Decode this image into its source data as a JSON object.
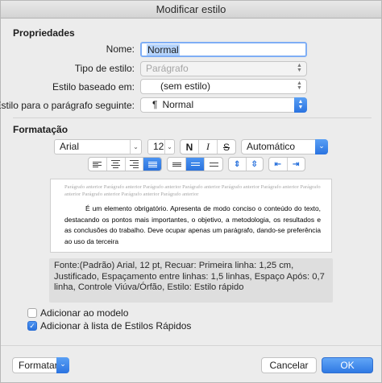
{
  "window": {
    "title": "Modificar estilo"
  },
  "properties": {
    "section_title": "Propriedades",
    "name_label": "Nome:",
    "name_value": "Normal",
    "style_type_label": "Tipo de estilo:",
    "style_type_value": "Parágrafo",
    "based_on_label": "Estilo baseado em:",
    "based_on_value": "(sem estilo)",
    "next_style_label": "Estilo para o parágrafo seguinte:",
    "next_style_symbol": "¶",
    "next_style_value": "Normal"
  },
  "formatting": {
    "section_title": "Formatação",
    "font": "Arial",
    "size": "12",
    "bold": "N",
    "italic": "I",
    "underline": "S",
    "color": "Automático"
  },
  "preview": {
    "ghost_text": "Parágrafo anterior Parágrafo anterior Parágrafo anterior Parágrafo anterior Parágrafo anterior Parágrafo anterior Parágrafo anterior Parágrafo anterior Parágrafo anterior Parágrafo anterior",
    "sample_text": "É um elemento obrigatório. Apresenta de modo conciso o conteúdo do texto, destacando os pontos mais importantes, o objetivo, a metodologia, os resultados e as conclusões do trabalho. Deve ocupar apenas um parágrafo, dando-se preferência ao uso da terceira"
  },
  "description": "Fonte:(Padrão) Arial, 12 pt, Recuar: Primeira linha: 1,25 cm, Justificado, Espaçamento entre linhas: 1,5 linhas, Espaço Após: 0,7 linha, Controle Viúva/Órfão, Estilo: Estilo rápido",
  "options": {
    "add_to_template_label": "Adicionar ao modelo",
    "add_to_template_checked": false,
    "add_to_quick_styles_label": "Adicionar à lista de Estilos Rápidos",
    "add_to_quick_styles_checked": true
  },
  "footer": {
    "format_button": "Formatar",
    "cancel_button": "Cancelar",
    "ok_button": "OK"
  },
  "colors": {
    "accent": "#2b73dd",
    "window_bg": "#ececec"
  }
}
